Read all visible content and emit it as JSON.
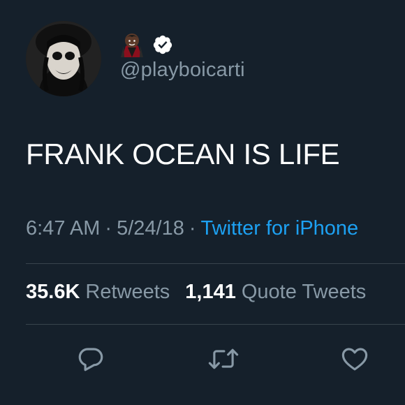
{
  "user": {
    "handle": "@playboicarti",
    "verified": true,
    "name_emoji": "vampire-emoji-icon"
  },
  "tweet": {
    "text": "FRANK OCEAN IS LIFE",
    "time": "6:47 AM",
    "date": "5/24/18",
    "separator": "·",
    "source": "Twitter for iPhone"
  },
  "stats": {
    "retweets_count": "35.6K",
    "retweets_label": "Retweets",
    "quotes_count": "1,141",
    "quotes_label": "Quote Tweets"
  },
  "actions": {
    "icons": [
      "reply-icon",
      "retweet-icon",
      "like-icon"
    ]
  },
  "colors": {
    "background": "#15202b",
    "text": "#ffffff",
    "secondary": "#8899a6",
    "accent": "#1da1f2",
    "divider": "#38444d"
  }
}
